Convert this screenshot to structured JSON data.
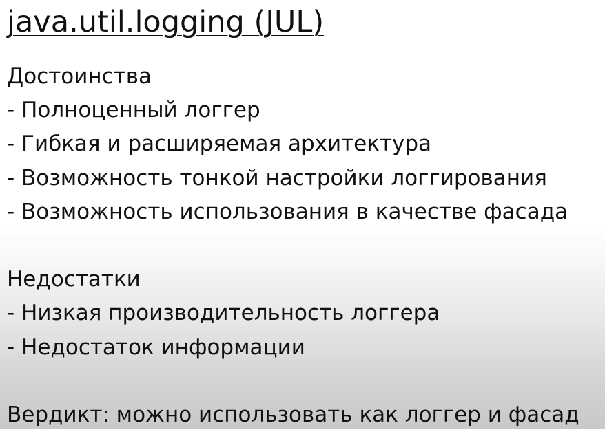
{
  "slide": {
    "title": "java.util.logging (JUL)",
    "pros": {
      "heading": "Достоинства",
      "items": [
        "- Полноценный логгер",
        "- Гибкая и расширяемая архитектура",
        "- Возможность тонкой настройки логгирования",
        "- Возможность использования в качестве фасада"
      ]
    },
    "cons": {
      "heading": "Недостатки",
      "items": [
        "- Низкая производительность логгера",
        "- Недостаток информации"
      ]
    },
    "verdict": "Вердикт: можно использовать как логгер и фасад"
  }
}
